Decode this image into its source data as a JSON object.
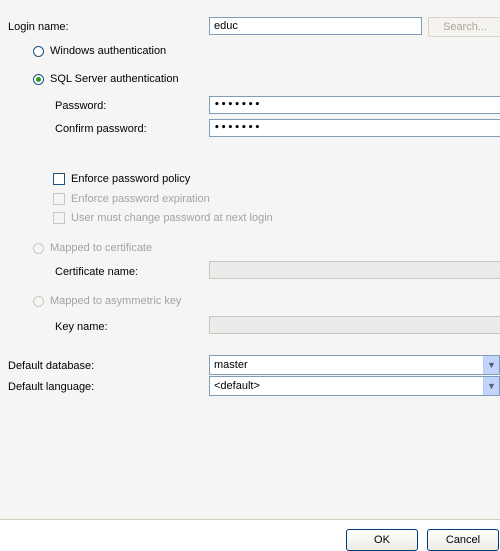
{
  "login_name": {
    "label": "Login name:",
    "value": "educ",
    "search_button": "Search..."
  },
  "auth": {
    "windows": {
      "label": "Windows authentication",
      "selected": false
    },
    "sql": {
      "label": "SQL Server authentication",
      "selected": true
    },
    "password": {
      "label": "Password:",
      "value": "•••••••"
    },
    "confirm_password": {
      "label": "Confirm password:",
      "value": "•••••••"
    }
  },
  "policy": {
    "enforce_policy": {
      "label": "Enforce password policy",
      "checked": false
    },
    "enforce_expiration": {
      "label": "Enforce password expiration",
      "checked": false,
      "enabled": false
    },
    "must_change": {
      "label": "User must change password at next login",
      "checked": false,
      "enabled": false
    }
  },
  "certificate": {
    "label": "Mapped to certificate",
    "name_label": "Certificate name:",
    "value": ""
  },
  "asymmetric_key": {
    "label": "Mapped to asymmetric key",
    "name_label": "Key name:",
    "value": ""
  },
  "default_database": {
    "label": "Default database:",
    "value": "master"
  },
  "default_language": {
    "label": "Default language:",
    "value": "<default>"
  },
  "buttons": {
    "ok": "OK",
    "cancel": "Cancel"
  }
}
